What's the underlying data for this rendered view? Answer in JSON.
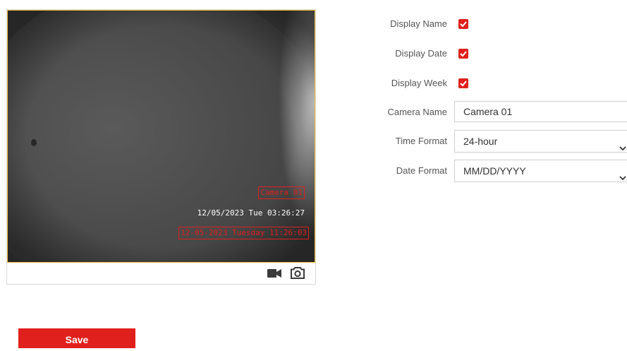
{
  "preview": {
    "osd_camera_name": "Camera 01",
    "osd_datetime": "12/05/2023 Tue 03:26:27",
    "osd_datetime_edit": "12-05-2023 Tuesday 11:26:03",
    "record_icon": "video-camera-icon",
    "snapshot_icon": "camera-icon"
  },
  "form": {
    "display_name_label": "Display Name",
    "display_date_label": "Display Date",
    "display_week_label": "Display Week",
    "camera_name_label": "Camera Name",
    "camera_name_value": "Camera 01",
    "time_format_label": "Time Format",
    "time_format_value": "24-hour",
    "date_format_label": "Date Format",
    "date_format_value": "MM/DD/YYYY",
    "display_name_checked": true,
    "display_date_checked": true,
    "display_week_checked": true
  },
  "actions": {
    "save_label": "Save"
  },
  "colors": {
    "accent": "#e0201c"
  }
}
